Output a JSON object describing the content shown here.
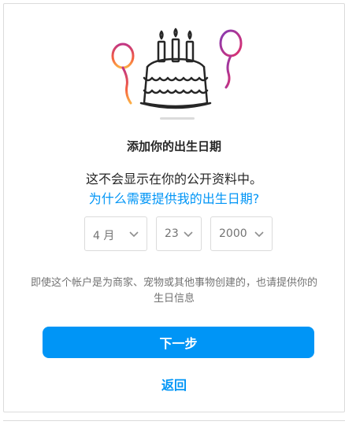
{
  "dialog": {
    "title": "添加你的出生日期",
    "subtitle": "这不会显示在你的公开资料中。",
    "why_link": "为什么需要提供我的出生日期?",
    "note": "即使这个帐户是为商家、宠物或其他事物创建的，也请提供你的生日信息",
    "next_label": "下一步",
    "back_label": "返回"
  },
  "birthday": {
    "month": "4 月",
    "day": "23",
    "year": "2000"
  },
  "colors": {
    "accent": "#0095f6",
    "text": "#262626",
    "muted": "#737373",
    "border": "#dbdbdb"
  },
  "icons": {
    "illustration": "birthday-cake-illustration",
    "dropdown": "chevron-down-icon"
  }
}
